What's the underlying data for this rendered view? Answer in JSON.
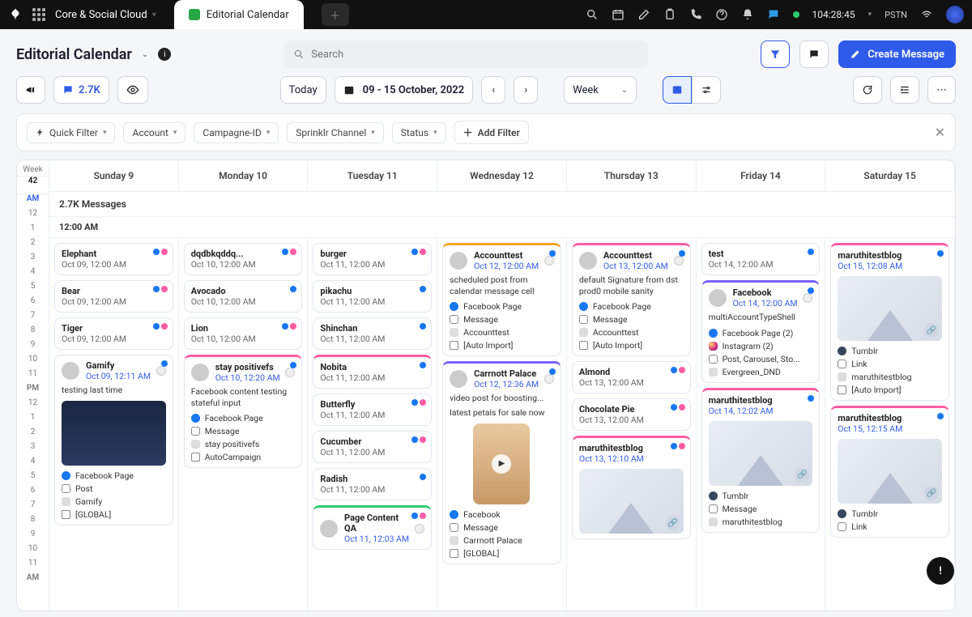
{
  "topbar": {
    "workspace": "Core & Social Cloud",
    "tab_label": "Editorial Calendar",
    "timer": "104:28:45",
    "pstn": "PSTN"
  },
  "header": {
    "title": "Editorial Calendar",
    "search_placeholder": "Search",
    "create_btn": "Create Message"
  },
  "toolbar": {
    "count": "2.7K",
    "today": "Today",
    "date_range": "09 - 15 October, 2022",
    "view": "Week"
  },
  "filters": {
    "quick": "Quick Filter",
    "account": "Account",
    "campaign": "Campagne-ID",
    "channel": "Sprinklr Channel",
    "status": "Status",
    "add": "Add Filter"
  },
  "week": {
    "label": "Week",
    "number": "42",
    "days": [
      "Sunday 9",
      "Monday 10",
      "Tuesday 11",
      "Wednesday 12",
      "Thursday 13",
      "Friday 14",
      "Saturday 15"
    ],
    "summary": "2.7K Messages",
    "timeslot": "12:00 AM"
  },
  "timeaxis": {
    "am": "AM",
    "pm": "PM",
    "hours_top": [
      "12",
      "1",
      "2",
      "3",
      "4",
      "5",
      "6",
      "7",
      "8",
      "9",
      "10",
      "11"
    ],
    "hours_bot": [
      "12",
      "1",
      "2",
      "3",
      "4",
      "5",
      "6",
      "7",
      "8",
      "9",
      "10",
      "11"
    ]
  },
  "cards": {
    "sun": [
      {
        "title": "Elephant",
        "date": "Oct 09, 12:00 AM"
      },
      {
        "title": "Bear",
        "date": "Oct 09, 12:00 AM"
      },
      {
        "title": "Tiger",
        "date": "Oct 09, 12:00 AM"
      },
      {
        "title": "Gamify",
        "date": "Oct 09, 12:11 AM",
        "date_link": true,
        "desc": "testing last time",
        "meta": [
          {
            "icon": "fb",
            "text": "Facebook Page"
          },
          {
            "icon": "msg",
            "text": "Post"
          },
          {
            "icon": "dot",
            "text": "Gamify"
          },
          {
            "icon": "auto",
            "text": "[GLOBAL]"
          }
        ],
        "image": true,
        "avatar": true
      }
    ],
    "mon": [
      {
        "title": "dqdbkqddq...",
        "date": "Oct 10, 12:00 AM"
      },
      {
        "title": "Avocado",
        "date": "Oct 10, 12:00 AM"
      },
      {
        "title": "Lion",
        "date": "Oct 10, 12:00 AM"
      },
      {
        "title": "stay positivefs",
        "date": "Oct 10, 12:20 AM",
        "date_link": true,
        "desc": "Facebook content testing stateful input",
        "avatar": true,
        "accent": "pink",
        "meta": [
          {
            "icon": "fb",
            "text": "Facebook Page"
          },
          {
            "icon": "msg",
            "text": "Message"
          },
          {
            "icon": "dot",
            "text": "stay positivefs"
          },
          {
            "icon": "auto",
            "text": "AutoCampaign"
          }
        ]
      }
    ],
    "tue": [
      {
        "title": "burger",
        "date": "Oct 11, 12:00 AM"
      },
      {
        "title": "pikachu",
        "date": "Oct 11, 12:00 AM"
      },
      {
        "title": "Shinchan",
        "date": "Oct 11, 12:00 AM"
      },
      {
        "title": "Nobita",
        "date": "Oct 11, 12:00 AM",
        "accent": "pink"
      },
      {
        "title": "Butterfly",
        "date": "Oct 11, 12:00 AM"
      },
      {
        "title": "Cucumber",
        "date": "Oct 11, 12:00 AM"
      },
      {
        "title": "Radish",
        "date": "Oct 11, 12:00 AM"
      },
      {
        "title": "Page Content QA",
        "date": "Oct 11, 12:03 AM",
        "date_link": true,
        "avatar": true,
        "accent": "green"
      }
    ],
    "wed": [
      {
        "title": "Accounttest",
        "date": "Oct 12, 12:00 AM",
        "date_link": true,
        "avatar": true,
        "accent": "orange",
        "desc": "scheduled post from calendar message cell",
        "meta": [
          {
            "icon": "fb",
            "text": "Facebook Page"
          },
          {
            "icon": "msg",
            "text": "Message"
          },
          {
            "icon": "dot",
            "text": "Accounttest"
          },
          {
            "icon": "auto",
            "text": "[Auto Import]"
          }
        ]
      },
      {
        "title": "Carrnott Palace",
        "date": "Oct 12, 12:36 AM",
        "date_link": true,
        "avatar": true,
        "accent": "purple",
        "desc": "video post for boosting...",
        "desc2": "latest petals for sale now",
        "video": true,
        "meta": [
          {
            "icon": "fb",
            "text": "Facebook"
          },
          {
            "icon": "msg",
            "text": "Message"
          },
          {
            "icon": "dot",
            "text": "Carrnott Palace"
          },
          {
            "icon": "auto",
            "text": "[GLOBAL]"
          }
        ]
      }
    ],
    "thu": [
      {
        "title": "Accounttest",
        "date": "Oct 13, 12:00 AM",
        "date_link": true,
        "avatar": true,
        "accent": "pink",
        "desc": "default Signature from dst prod0 mobile sanity",
        "meta": [
          {
            "icon": "fb",
            "text": "Facebook Page"
          },
          {
            "icon": "msg",
            "text": "Message"
          },
          {
            "icon": "dot",
            "text": "Accounttest"
          },
          {
            "icon": "auto",
            "text": "[Auto Import]"
          }
        ]
      },
      {
        "title": "Almond",
        "date": "Oct 13, 12:00 AM"
      },
      {
        "title": "Chocolate Pie",
        "date": "Oct 13, 12:00 AM"
      },
      {
        "title": "maruthitestblog",
        "date": "Oct 13, 12:10 AM",
        "date_link": true,
        "accent": "pink",
        "thumb": true
      }
    ],
    "fri": [
      {
        "title": "test",
        "date": "Oct 14, 12:00 AM"
      },
      {
        "title": "Facebook",
        "date": "Oct 14, 12:00 AM",
        "date_link": true,
        "avatar": true,
        "accent": "purple",
        "desc": "multiAccountTypeShell",
        "meta": [
          {
            "icon": "fb",
            "text": "Facebook Page (2)"
          },
          {
            "icon": "ig",
            "text": "Instagram (2)"
          },
          {
            "icon": "msg",
            "text": "Post, Carousel, Sto..."
          },
          {
            "icon": "dot",
            "text": "Evergreen_DND"
          }
        ]
      },
      {
        "title": "maruthitestblog",
        "date": "Oct 14, 12:02 AM",
        "date_link": true,
        "accent": "pink",
        "thumb": true,
        "meta": [
          {
            "icon": "tumblr",
            "text": "Tumblr"
          },
          {
            "icon": "msg",
            "text": "Message"
          },
          {
            "icon": "dot",
            "text": "maruthitestblog"
          }
        ]
      }
    ],
    "sat": [
      {
        "title": "maruthitestblog",
        "date": "Oct 15, 12:08 AM",
        "date_link": true,
        "accent": "pink",
        "thumb": true,
        "meta": [
          {
            "icon": "tumblr",
            "text": "Tumblr"
          },
          {
            "icon": "msg",
            "text": "Link"
          },
          {
            "icon": "dot",
            "text": "maruthitestblog"
          },
          {
            "icon": "auto",
            "text": "[Auto Import]"
          }
        ]
      },
      {
        "title": "maruthitestblog",
        "date": "Oct 15, 12:15 AM",
        "date_link": true,
        "accent": "pink",
        "thumb": true,
        "meta": [
          {
            "icon": "tumblr",
            "text": "Tumblr"
          },
          {
            "icon": "msg",
            "text": "Link"
          }
        ]
      }
    ]
  }
}
